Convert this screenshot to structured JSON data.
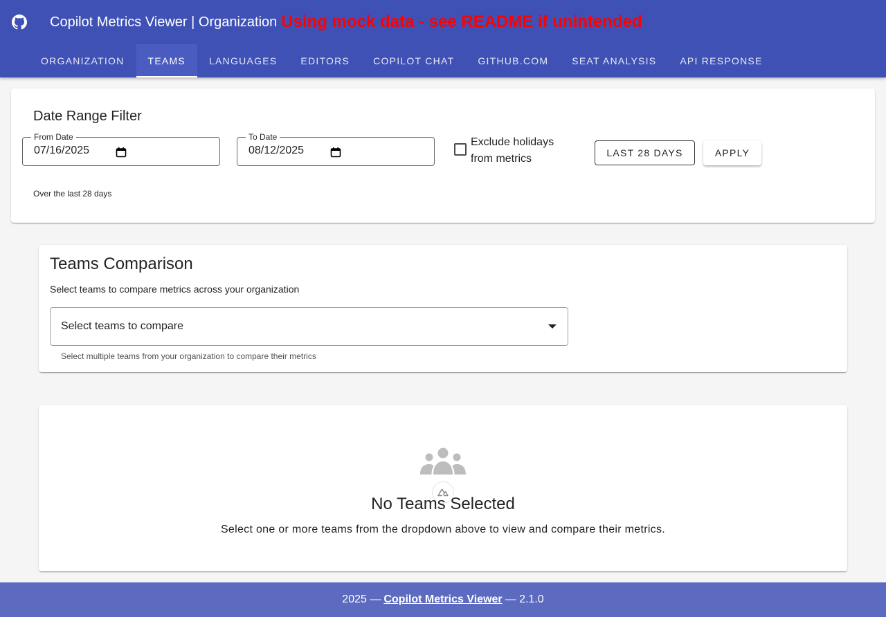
{
  "header": {
    "title": "Copilot Metrics Viewer | Organization",
    "mock_warning": "Using mock data - see README if unintended",
    "colors": {
      "appbar": "#3f51b5",
      "warning": "#ff0000"
    }
  },
  "tabs": [
    {
      "label": "Organization",
      "active": false
    },
    {
      "label": "Teams",
      "active": true
    },
    {
      "label": "Languages",
      "active": false
    },
    {
      "label": "Editors",
      "active": false
    },
    {
      "label": "Copilot Chat",
      "active": false
    },
    {
      "label": "github.com",
      "active": false
    },
    {
      "label": "Seat Analysis",
      "active": false
    },
    {
      "label": "API Response",
      "active": false
    }
  ],
  "date_filter": {
    "title": "Date Range Filter",
    "from_label": "From Date",
    "from_value": "07/16/2025",
    "to_label": "To Date",
    "to_value": "08/12/2025",
    "exclude_holidays_label": "Exclude holidays from metrics",
    "exclude_holidays_checked": false,
    "last28_button": "Last 28 Days",
    "apply_button": "Apply",
    "summary": "Over the last 28 days"
  },
  "teams_comparison": {
    "title": "Teams Comparison",
    "subtitle": "Select teams to compare metrics across your organization",
    "select_placeholder": "Select teams to compare",
    "select_hint": "Select multiple teams from your organization to compare their metrics"
  },
  "empty_state": {
    "icon": "account-group-icon",
    "title": "No Teams Selected",
    "message": "Select one or more teams from the dropdown above to view and compare their metrics."
  },
  "footer": {
    "year": "2025 —",
    "link": "Copilot Metrics Viewer",
    "version": "— 2.1.0"
  }
}
